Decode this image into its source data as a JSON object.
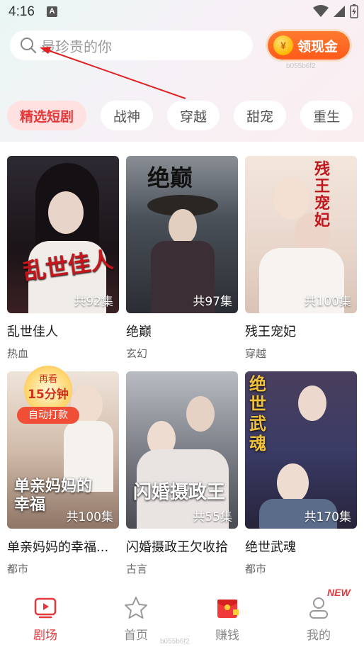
{
  "status_bar": {
    "time": "4:16",
    "notification_letter": "A"
  },
  "search": {
    "placeholder": "最珍贵的你"
  },
  "cash_button": {
    "label": "领现金",
    "coin_symbol": "¥"
  },
  "watermark": "b055b6f2",
  "tabs": [
    {
      "label": "精选短剧",
      "active": true
    },
    {
      "label": "战神",
      "active": false
    },
    {
      "label": "穿越",
      "active": false
    },
    {
      "label": "甜宠",
      "active": false
    },
    {
      "label": "重生",
      "active": false
    }
  ],
  "dramas": [
    {
      "title": "乱世佳人",
      "genre": "热血",
      "episodes": "共92集",
      "poster_color": "#2a2230"
    },
    {
      "title": "绝巅",
      "genre": "玄幻",
      "episodes": "共97集",
      "poster_color": "#3a4046"
    },
    {
      "title": "残王宠妃",
      "genre": "穿越",
      "episodes": "共100集",
      "poster_color": "#e9d9cf"
    },
    {
      "title": "单亲妈妈的幸福...",
      "genre": "都市",
      "episodes": "共100集",
      "poster_color": "#cdb5a4"
    },
    {
      "title": "闪婚摄政王欠收拾",
      "genre": "古言",
      "episodes": "共55集",
      "poster_color": "#6b6f78"
    },
    {
      "title": "绝世武魂",
      "genre": "都市",
      "episodes": "共170集",
      "poster_color": "#3d3550"
    }
  ],
  "poster_texts": {
    "p1_logo": "乱世佳人",
    "p2_logo": "绝巅",
    "p3_logo": "残王宠妃",
    "p4_logo": "单亲妈妈的幸福",
    "p5_logo": "闪婚摄政王",
    "p6_logo": "绝世武魂"
  },
  "promo_badge": {
    "top": "再看",
    "middle": "15分钟",
    "bottom": "自动打款"
  },
  "bottom_nav": [
    {
      "label": "剧场",
      "icon": "tv-icon",
      "active": true
    },
    {
      "label": "首页",
      "icon": "star-icon",
      "active": false
    },
    {
      "label": "赚钱",
      "icon": "red-envelope-icon",
      "active": false
    },
    {
      "label": "我的",
      "icon": "person-icon",
      "active": false
    }
  ],
  "new_tag": "NEW",
  "accent_color": "#e4393c"
}
